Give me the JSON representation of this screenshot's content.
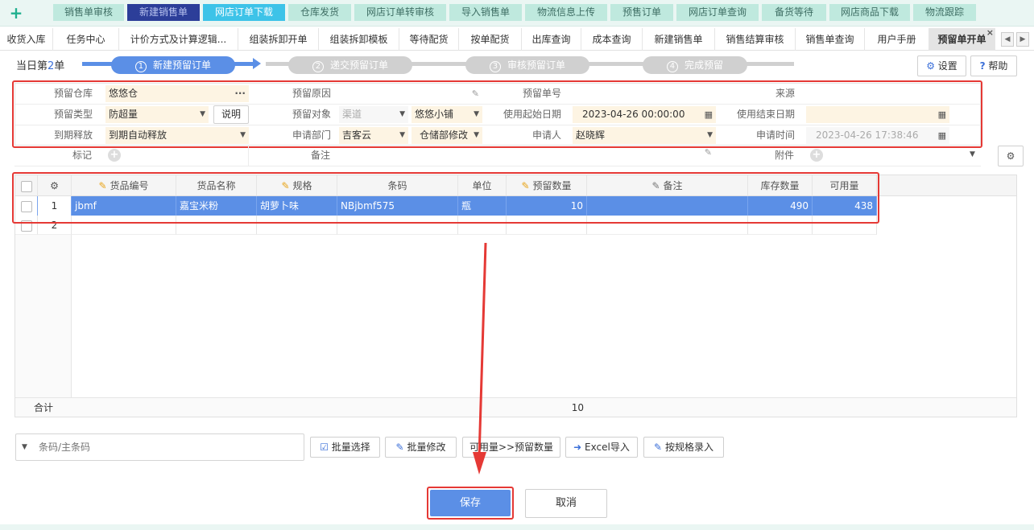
{
  "topnav": {
    "items": [
      "销售单审核",
      "新建销售单",
      "网店订单下载",
      "仓库发货",
      "网店订单转审核",
      "导入销售单",
      "物流信息上传",
      "预售订单",
      "网店订单查询",
      "备货等待",
      "网店商品下载",
      "物流跟踪"
    ]
  },
  "tabs": [
    "收货入库",
    "任务中心",
    "计价方式及计算逻辑...",
    "组装拆卸开单",
    "组装拆卸模板",
    "等待配货",
    "按单配货",
    "出库查询",
    "成本查询",
    "新建销售单",
    "销售结算审核",
    "销售单查询",
    "用户手册",
    "预留单开单"
  ],
  "header": {
    "today_prefix": "当日第",
    "today_count": "2",
    "today_suffix": "单",
    "settings": "设置",
    "help": "帮助"
  },
  "steps": [
    {
      "num": "1",
      "label": "新建预留订单"
    },
    {
      "num": "2",
      "label": "递交预留订单"
    },
    {
      "num": "3",
      "label": "审核预留订单"
    },
    {
      "num": "4",
      "label": "完成预留"
    }
  ],
  "form": {
    "warehouse_label": "预留仓库",
    "warehouse": "悠悠仓",
    "reason_label": "预留原因",
    "reason": "",
    "order_no_label": "预留单号",
    "order_no": "",
    "source_label": "来源",
    "source": "",
    "type_label": "预留类型",
    "type": "防超量",
    "explain": "说明",
    "target_label": "预留对象",
    "channel": "渠道",
    "shop": "悠悠小铺",
    "start_label": "使用起始日期",
    "start": "2023-04-26 00:00:00",
    "end_label": "使用结束日期",
    "end": "",
    "release_label": "到期释放",
    "release": "到期自动释放",
    "dept_label": "申请部门",
    "dept1": "吉客云",
    "dept2": "仓储部修改",
    "applicant_label": "申请人",
    "applicant": "赵晓辉",
    "apply_time_label": "申请时间",
    "apply_time": "2023-04-26 17:38:46",
    "mark_label": "标记",
    "remark_label": "备注",
    "attach_label": "附件"
  },
  "table": {
    "columns": [
      "货品编号",
      "货品名称",
      "规格",
      "条码",
      "单位",
      "预留数量",
      "备注",
      "库存数量",
      "可用量"
    ],
    "rows": [
      {
        "idx": "1",
        "code": "jbmf",
        "name": "嘉宝米粉",
        "spec": "胡萝卜味",
        "barcode": "NBjbmf575",
        "unit": "瓶",
        "qty": "10",
        "note": "",
        "stock": "490",
        "avail": "438"
      },
      {
        "idx": "2"
      }
    ],
    "total_label": "合计",
    "total_qty": "10"
  },
  "toolbar": {
    "barcode_placeholder": "条码/主条码",
    "batch_select": "批量选择",
    "batch_edit": "批量修改",
    "avail_to_qty": "可用量>>预留数量",
    "excel_import": "Excel导入",
    "spec_entry": "按规格录入"
  },
  "actions": {
    "save": "保存",
    "cancel": "取消"
  },
  "colors": {
    "accent": "#5b8fe6",
    "annotation": "#e53935"
  }
}
